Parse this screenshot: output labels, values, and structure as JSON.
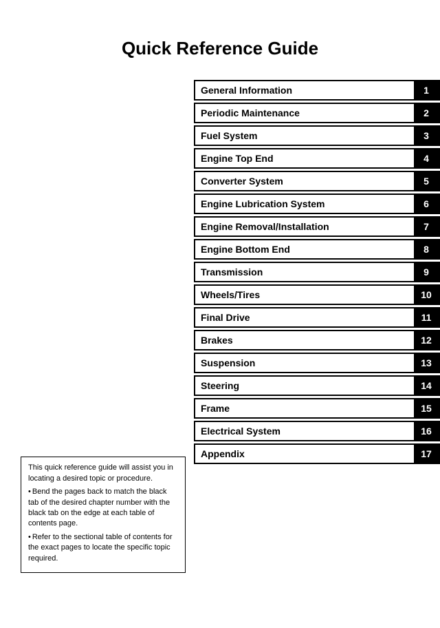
{
  "title": "Quick Reference Guide",
  "toc": [
    {
      "label": "General Information",
      "number": "1"
    },
    {
      "label": "Periodic Maintenance",
      "number": "2"
    },
    {
      "label": "Fuel System",
      "number": "3"
    },
    {
      "label": "Engine Top End",
      "number": "4"
    },
    {
      "label": "Converter System",
      "number": "5"
    },
    {
      "label": "Engine Lubrication System",
      "number": "6"
    },
    {
      "label": "Engine Removal/Installation",
      "number": "7"
    },
    {
      "label": "Engine Bottom End",
      "number": "8"
    },
    {
      "label": "Transmission",
      "number": "9"
    },
    {
      "label": "Wheels/Tires",
      "number": "10"
    },
    {
      "label": "Final Drive",
      "number": "11"
    },
    {
      "label": "Brakes",
      "number": "12"
    },
    {
      "label": "Suspension",
      "number": "13"
    },
    {
      "label": "Steering",
      "number": "14"
    },
    {
      "label": "Frame",
      "number": "15"
    },
    {
      "label": "Electrical System",
      "number": "16"
    },
    {
      "label": "Appendix",
      "number": "17"
    }
  ],
  "note": {
    "intro": "This quick reference guide will assist you in locating a desired topic or procedure.",
    "bullets": [
      "Bend the pages back to match the black tab of the desired chapter number with the black tab on the edge at each table of contents page.",
      "Refer to the sectional table of contents for the exact pages to locate the specific topic required."
    ]
  }
}
